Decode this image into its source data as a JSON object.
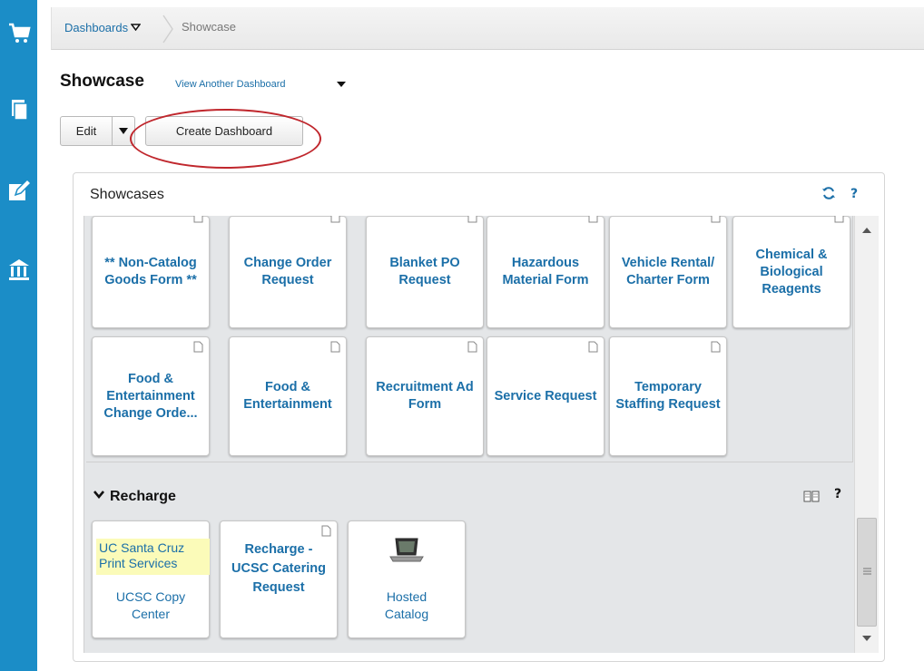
{
  "breadcrumb": {
    "root": "Dashboards",
    "current": "Showcase"
  },
  "page": {
    "title": "Showcase",
    "view_another": "View Another Dashboard"
  },
  "toolbar": {
    "edit_label": "Edit",
    "create_label": "Create Dashboard"
  },
  "panel": {
    "title": "Showcases",
    "help": "?"
  },
  "showcase_tiles": [
    "** Non-Catalog Goods Form **",
    "Change Order Request",
    "Blanket PO Request",
    "Hazardous Material Form",
    "Vehicle Rental/ Charter Form",
    "Chemical & Biological Reagents",
    "Food & Entertainment Change Orde...",
    "Food & Entertainment",
    "Recruitment Ad Form",
    "Service Request",
    "Temporary Staffing Request"
  ],
  "recharge": {
    "heading": "Recharge",
    "help": "?",
    "tiles": [
      {
        "badge": "UC Santa Cruz Print Services",
        "caption": "UCSC Copy Center"
      },
      {
        "caption": "Recharge - UCSC Catering Request"
      },
      {
        "caption": "Hosted Catalog"
      }
    ]
  },
  "colors": {
    "rail": "#1b8dc7",
    "link": "#1b6fa8",
    "highlight_circle": "#c0272d",
    "badge_bg": "#fbfbb9"
  },
  "icons": [
    "cart-icon",
    "documents-icon",
    "edit-icon",
    "bank-icon",
    "refresh-icon",
    "book-icon",
    "document-icon",
    "laptop-icon"
  ]
}
